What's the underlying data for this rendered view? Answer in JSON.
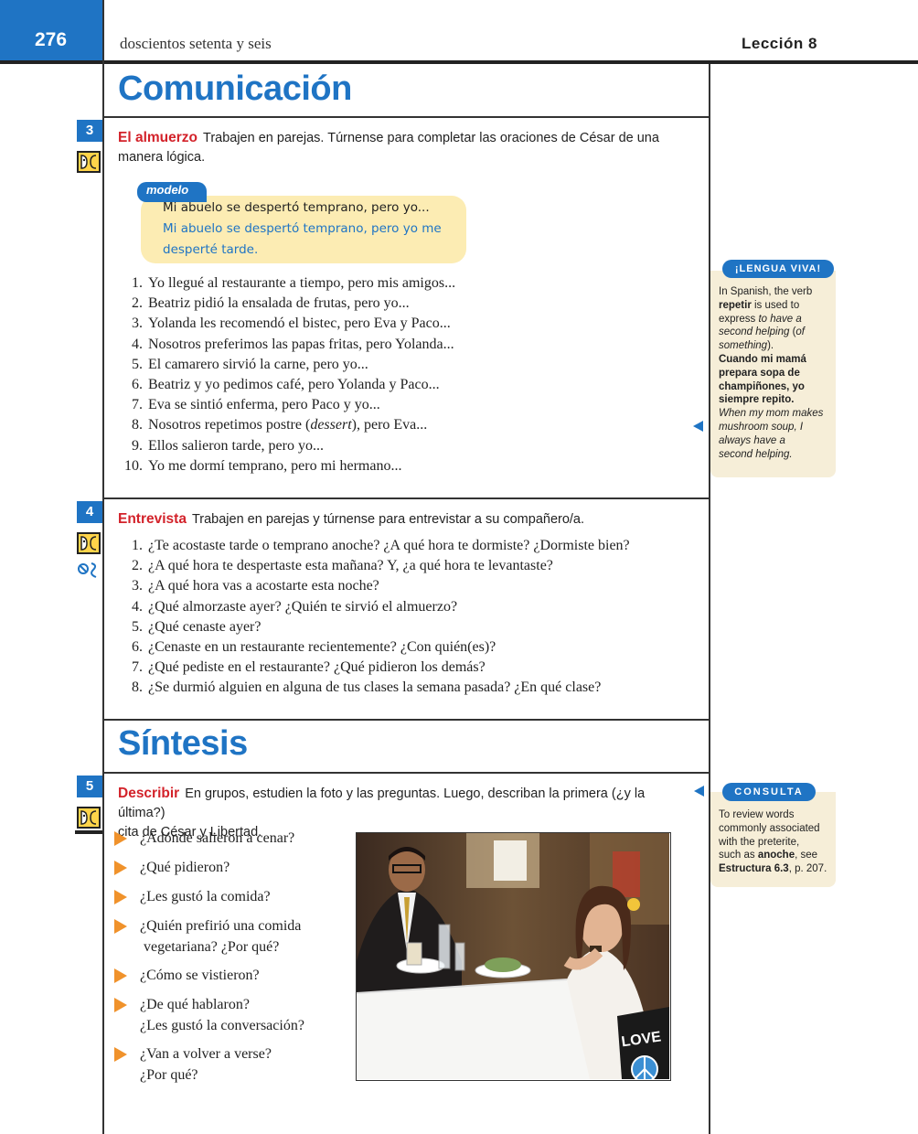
{
  "header": {
    "page_number": "276",
    "page_words": "doscientos setenta y seis",
    "lesson": "Lección 8"
  },
  "sections": {
    "comunicacion": "Comunicación",
    "sintesis": "Síntesis"
  },
  "ex3": {
    "number": "3",
    "keyword": "El almuerzo",
    "instruction": "Trabajen en parejas. Túrnense para completar las oraciones de César de una",
    "instruction2": "manera lógica.",
    "modelo_label": "modelo",
    "modelo_q": "Mi abuelo se despertó temprano, pero yo...",
    "modelo_a1": "Mi abuelo se despertó temprano, pero yo me",
    "modelo_a2": "desperté tarde.",
    "items": [
      {
        "n": "1.",
        "pre": "Yo llegué al restaurante a tiempo, pero mis amigos...",
        "it": "",
        "post": ""
      },
      {
        "n": "2.",
        "pre": "Beatriz pidió la ensalada de frutas, pero yo...",
        "it": "",
        "post": ""
      },
      {
        "n": "3.",
        "pre": "Yolanda les recomendó el bistec, pero Eva y Paco...",
        "it": "",
        "post": ""
      },
      {
        "n": "4.",
        "pre": "Nosotros preferimos las papas fritas, pero Yolanda...",
        "it": "",
        "post": ""
      },
      {
        "n": "5.",
        "pre": "El camarero sirvió la carne, pero yo...",
        "it": "",
        "post": ""
      },
      {
        "n": "6.",
        "pre": "Beatriz y yo pedimos café, pero Yolanda y Paco...",
        "it": "",
        "post": ""
      },
      {
        "n": "7.",
        "pre": "Eva se sintió enferma, pero Paco y yo...",
        "it": "",
        "post": ""
      },
      {
        "n": "8.",
        "pre": "Nosotros repetimos postre (",
        "it": "dessert",
        "post": "), pero Eva..."
      },
      {
        "n": "9.",
        "pre": "Ellos salieron tarde, pero yo...",
        "it": "",
        "post": ""
      },
      {
        "n": "10.",
        "pre": "Yo me dormí temprano, pero mi hermano...",
        "it": "",
        "post": ""
      }
    ]
  },
  "ex4": {
    "number": "4",
    "keyword": "Entrevista",
    "instruction": "Trabajen en parejas y túrnense para entrevistar a su compañero/a.",
    "items": [
      {
        "n": "1.",
        "text": "¿Te acostaste tarde o temprano anoche? ¿A qué hora te dormiste? ¿Dormiste bien?"
      },
      {
        "n": "2.",
        "text": "¿A qué hora te despertaste esta mañana? Y, ¿a qué hora te levantaste?"
      },
      {
        "n": "3.",
        "text": "¿A qué hora vas a acostarte esta noche?"
      },
      {
        "n": "4.",
        "text": "¿Qué almorzaste ayer? ¿Quién te sirvió el almuerzo?"
      },
      {
        "n": "5.",
        "text": "¿Qué cenaste ayer?"
      },
      {
        "n": "6.",
        "text": "¿Cenaste en un restaurante recientemente? ¿Con quién(es)?"
      },
      {
        "n": "7.",
        "text": "¿Qué pediste en el restaurante? ¿Qué pidieron los demás?"
      },
      {
        "n": "8.",
        "text": "¿Se durmió alguien en alguna de tus clases la semana pasada? ¿En qué clase?"
      }
    ]
  },
  "ex5": {
    "number": "5",
    "keyword": "Describir",
    "instruction": "En grupos, estudien la foto y las preguntas. Luego, describan la primera (¿y la última?)",
    "instruction2": "cita de César y Libertad.",
    "questions": [
      {
        "l1": "¿Adónde salieron a cenar?",
        "l2": ""
      },
      {
        "l1": "¿Qué pidieron?",
        "l2": ""
      },
      {
        "l1": "¿Les gustó la comida?",
        "l2": ""
      },
      {
        "l1": "¿Quién prefirió una comida",
        "l2": " vegetariana? ¿Por qué?"
      },
      {
        "l1": "¿Cómo se vistieron?",
        "l2": ""
      },
      {
        "l1": "¿De qué hablaron?",
        "l2": "¿Les gustó la conversación?"
      },
      {
        "l1": "¿Van a volver a verse?",
        "l2": "¿Por qué?"
      }
    ],
    "photo_bag_text": "LOVE"
  },
  "lengua_viva": {
    "tab": "¡LENGUA VIVA!",
    "l1": "In Spanish, the verb",
    "l2b": "repetir",
    "l2": " is used to",
    "l3": "express ",
    "l3i": "to have a",
    "l4i": "second helping",
    "l4": " (",
    "l4i2": "of",
    "l5i": "something",
    "l5": ").",
    "b1": "Cuando mi mamá",
    "b2": "prepara sopa de",
    "b3": "champiñones, yo",
    "b4": "siempre repito.",
    "i1": "When my mom makes",
    "i2": "mushroom soup, I",
    "i3": "always have a",
    "i4": "second helping."
  },
  "consulta": {
    "tab": "CONSULTA",
    "l1": "To review words",
    "l2": "commonly associated",
    "l3": "with the preterite,",
    "l4": "such as ",
    "l4b": "anoche",
    "l4e": ", see",
    "l5b": "Estructura 6.3",
    "l5": ", p. 207."
  },
  "colors": {
    "blue": "#1f74c4",
    "red": "#d3222a",
    "orange": "#f0922b",
    "cream": "#fcecb3"
  }
}
